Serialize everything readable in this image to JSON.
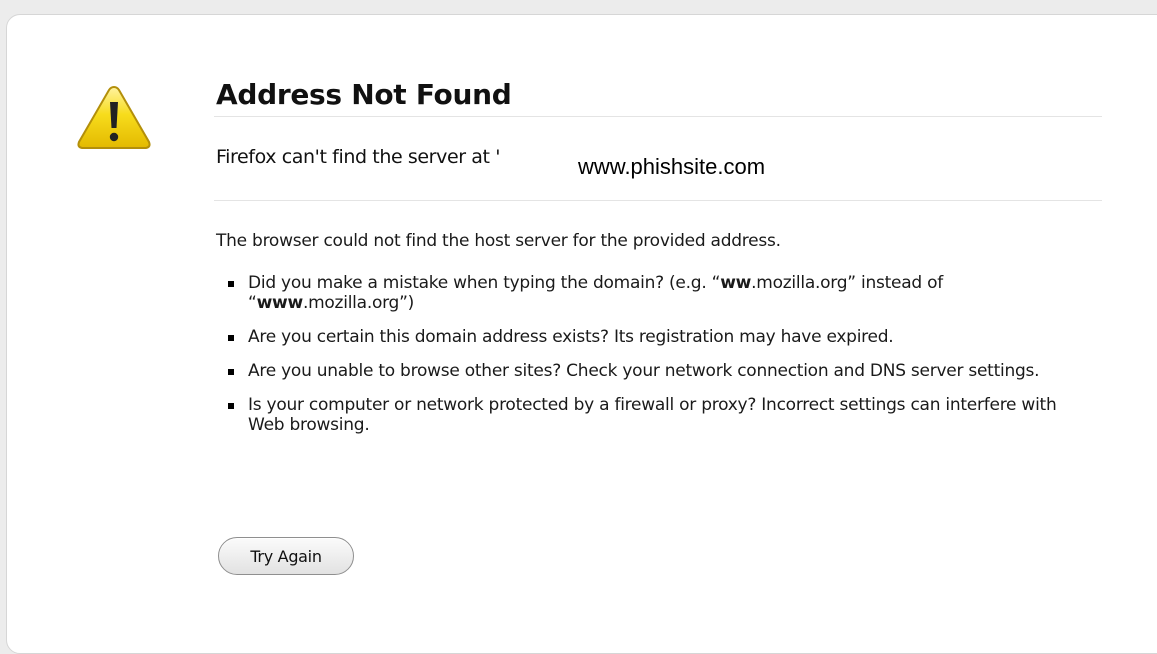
{
  "error": {
    "title": "Address Not Found",
    "short_desc_prefix": "Firefox can't find the server at",
    "short_desc_stub": "'",
    "url": "www.phishsite.com",
    "intro": "The browser could not find the host server for the provided address.",
    "hint_1": {
      "pre": "Did you make a mistake when typing the domain? (e.g. “",
      "bold_1": "ww",
      "mid_1": ".mozilla.org” instead of “",
      "bold_2": "www",
      "post": ".mozilla.org”)"
    },
    "hint_2": "Are you certain this domain address exists? Its registration may have expired.",
    "hint_3": "Are you unable to browse other sites? Check your network connection and DNS server settings.",
    "hint_4": "Is your computer or network protected by a firewall or proxy? Incorrect settings can interfere with Web browsing."
  },
  "actions": {
    "try_again_label": "Try Again"
  },
  "icons": {
    "warning": "warning-icon"
  },
  "colors": {
    "warning_yellow": "#f5d90a",
    "warning_border": "#b89a10",
    "page_bg": "#ffffff",
    "outer_bg": "#ececec"
  }
}
